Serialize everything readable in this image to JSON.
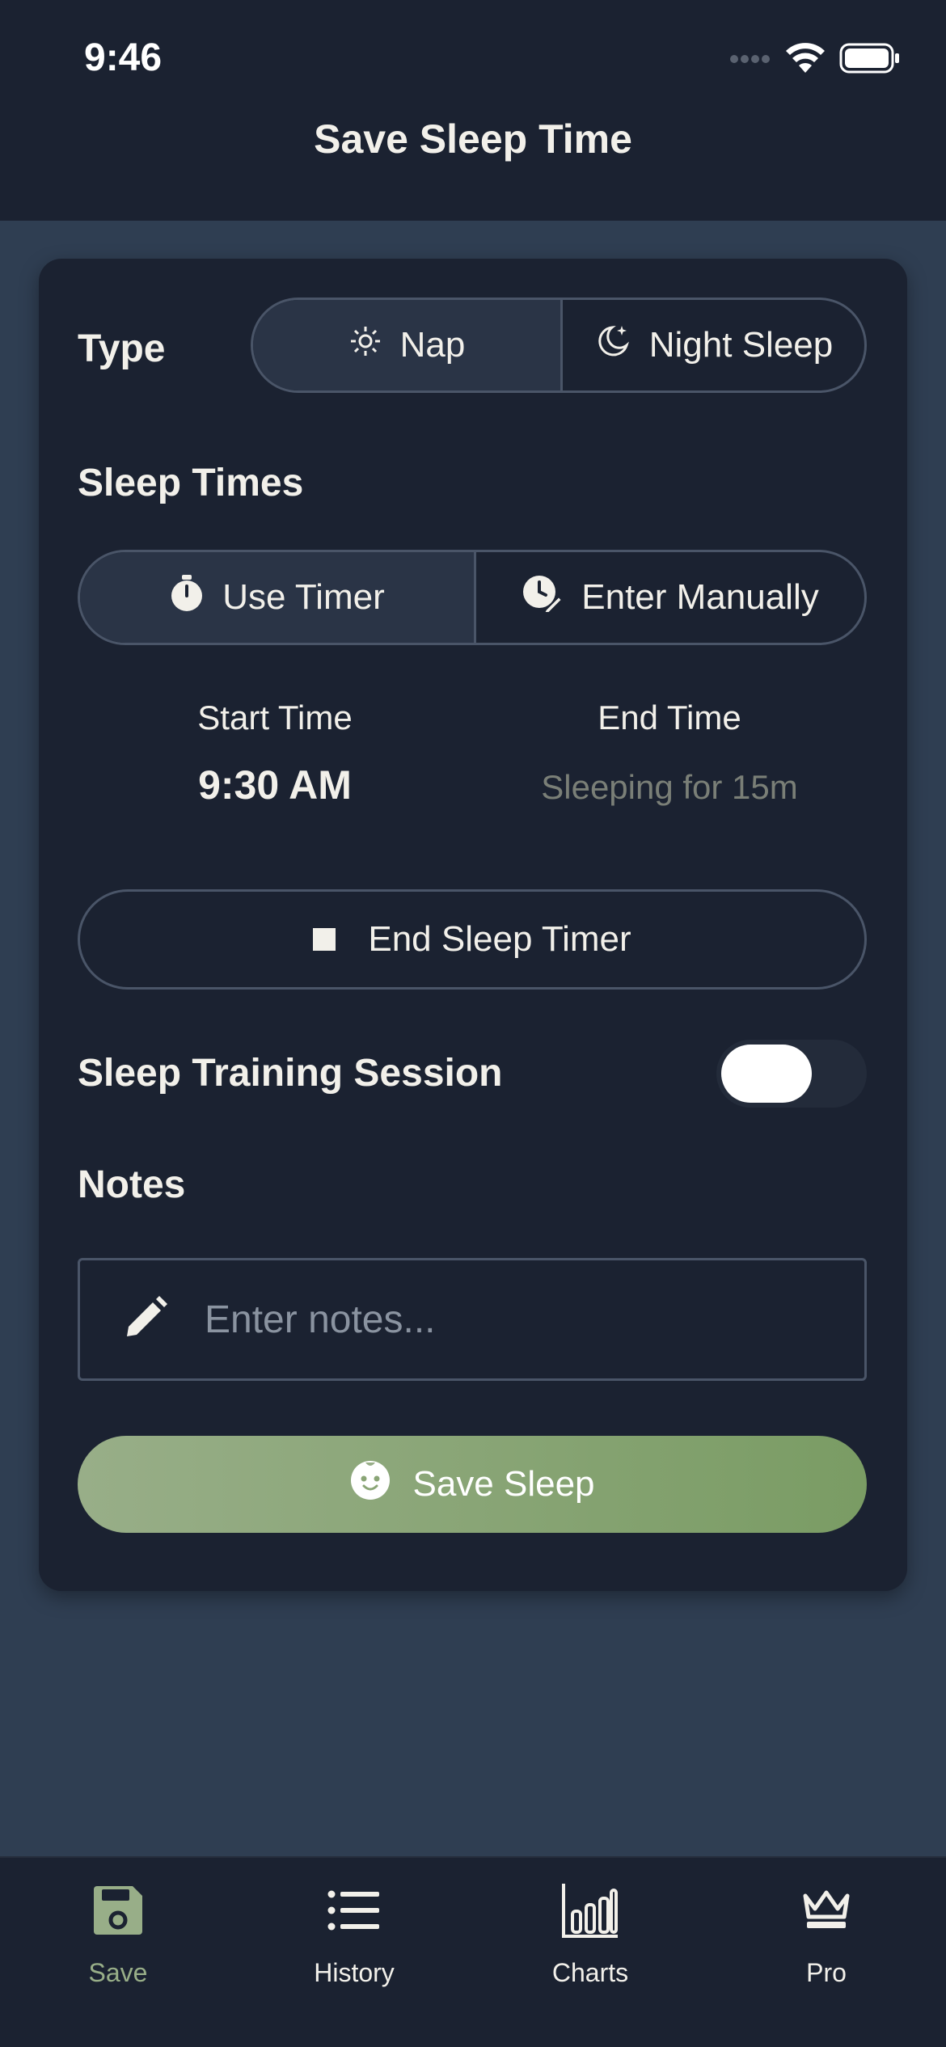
{
  "status_bar": {
    "time": "9:46"
  },
  "header": {
    "title": "Save Sleep Time"
  },
  "type_section": {
    "label": "Type",
    "options": [
      {
        "label": "Nap",
        "icon": "sun-icon",
        "selected": true
      },
      {
        "label": "Night Sleep",
        "icon": "moon-stars-icon",
        "selected": false
      }
    ]
  },
  "sleep_times": {
    "label": "Sleep Times",
    "modes": [
      {
        "label": "Use Timer",
        "icon": "stopwatch-icon",
        "selected": true
      },
      {
        "label": "Enter Manually",
        "icon": "clock-edit-icon",
        "selected": false
      }
    ],
    "start_label": "Start Time",
    "start_value": "9:30 AM",
    "end_label": "End Time",
    "end_value": "Sleeping for 15m"
  },
  "end_timer_button": {
    "label": "End Sleep Timer"
  },
  "sleep_training": {
    "label": "Sleep Training Session",
    "enabled": false
  },
  "notes": {
    "label": "Notes",
    "placeholder": "Enter notes...",
    "value": ""
  },
  "save_button": {
    "label": "Save Sleep"
  },
  "tabs": [
    {
      "label": "Save",
      "icon": "floppy-disk-icon",
      "active": true
    },
    {
      "label": "History",
      "icon": "list-icon",
      "active": false
    },
    {
      "label": "Charts",
      "icon": "bar-chart-icon",
      "active": false
    },
    {
      "label": "Pro",
      "icon": "crown-icon",
      "active": false
    }
  ],
  "colors": {
    "background": "#2f3e52",
    "surface": "#1b2231",
    "accent": "#98ae88",
    "accent_dark": "#7a9c64",
    "border": "#4a5568",
    "muted_text": "#7a7f77"
  }
}
